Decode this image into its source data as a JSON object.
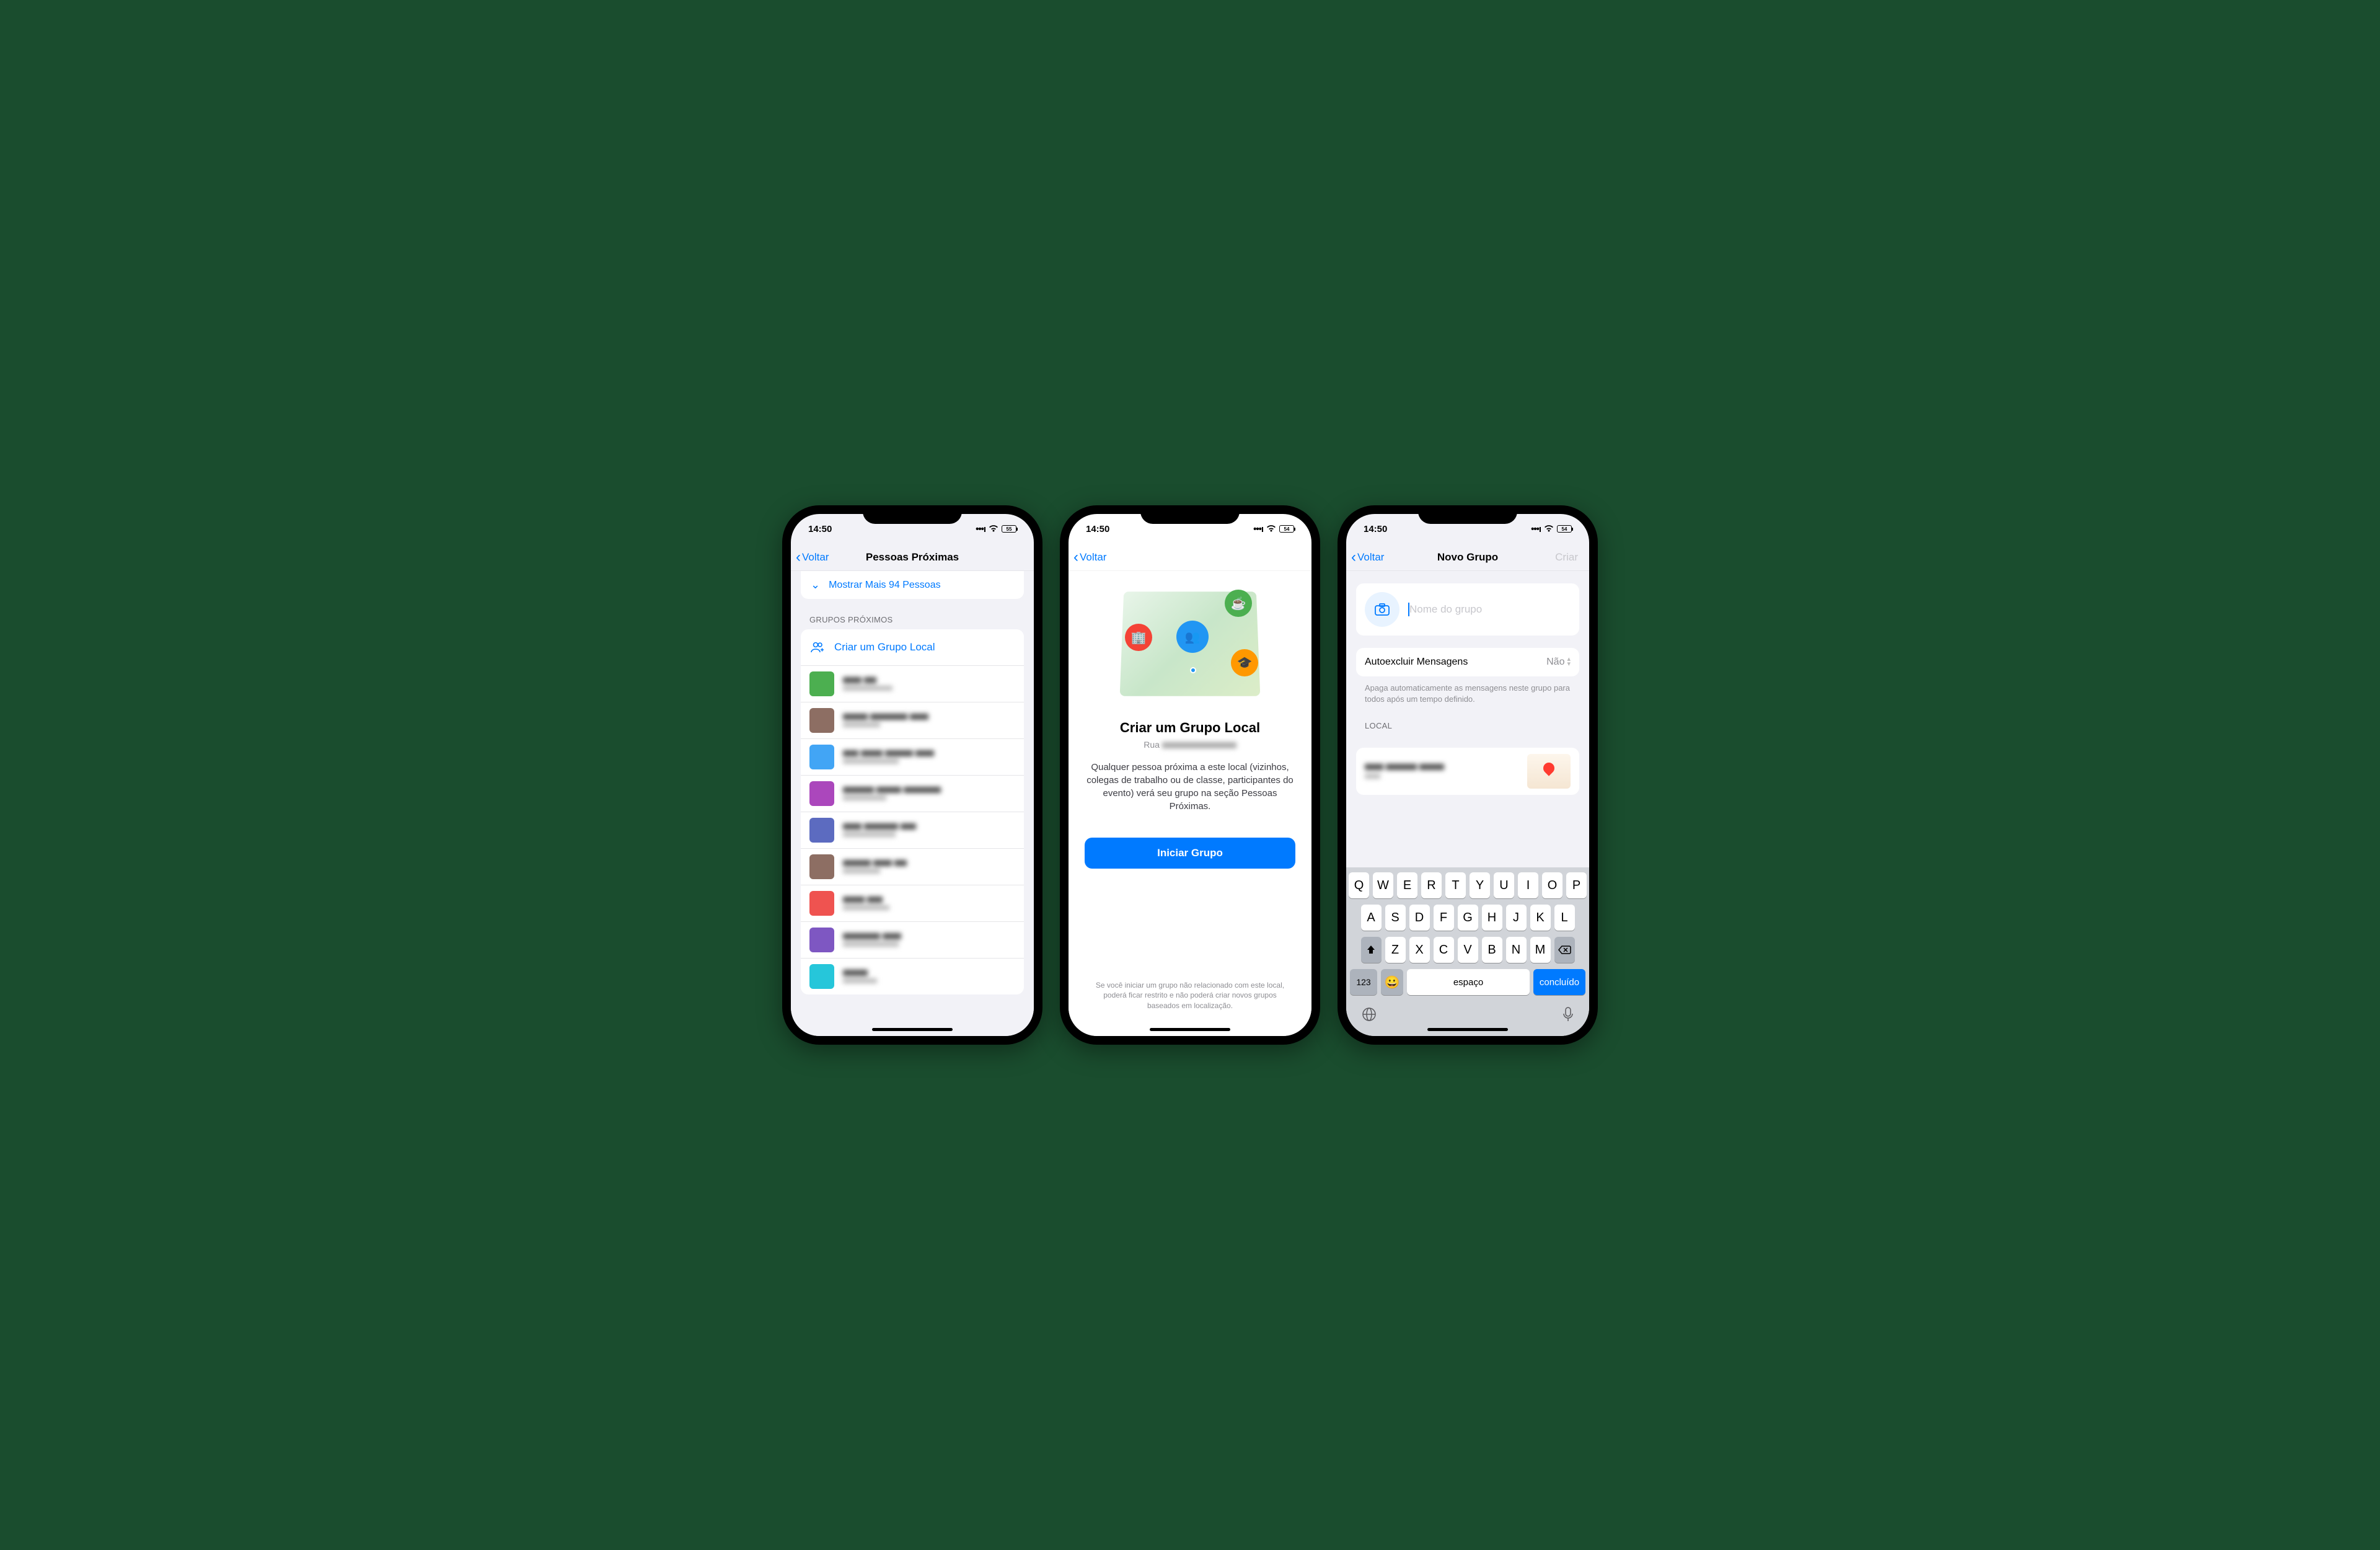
{
  "status": {
    "time": "14:50",
    "battery1": "55",
    "battery2": "54",
    "battery3": "54"
  },
  "nav": {
    "back": "Voltar",
    "title1": "Pessoas Próximas",
    "title3": "Novo Grupo",
    "create": "Criar"
  },
  "screen1": {
    "show_more": "Mostrar Mais 94 Pessoas",
    "groups_header": "GRUPOS PRÓXIMOS",
    "create_local": "Criar um Grupo Local"
  },
  "screen2": {
    "title": "Criar um Grupo Local",
    "street_prefix": "Rua",
    "description": "Qualquer pessoa próxima a este local (vizinhos, colegas de trabalho ou de classe, participantes do evento) verá seu grupo na seção Pessoas Próximas.",
    "button": "Iniciar Grupo",
    "footnote": "Se você iniciar um grupo não relacionado com este local, poderá ficar restrito e não poderá criar novos grupos baseados em localização."
  },
  "screen3": {
    "name_placeholder": "Nome do grupo",
    "autodel_label": "Autoexcluir Mensagens",
    "autodel_value": "Não",
    "autodel_hint": "Apaga automaticamente as mensagens neste grupo para todos após um tempo definido.",
    "local_header": "LOCAL"
  },
  "keyboard": {
    "r1": [
      "Q",
      "W",
      "E",
      "R",
      "T",
      "Y",
      "U",
      "I",
      "O",
      "P"
    ],
    "r2": [
      "A",
      "S",
      "D",
      "F",
      "G",
      "H",
      "J",
      "K",
      "L"
    ],
    "r3": [
      "Z",
      "X",
      "C",
      "V",
      "B",
      "N",
      "M"
    ],
    "n123": "123",
    "space": "espaço",
    "done": "concluído"
  },
  "colors": {
    "accent": "#007aff"
  }
}
